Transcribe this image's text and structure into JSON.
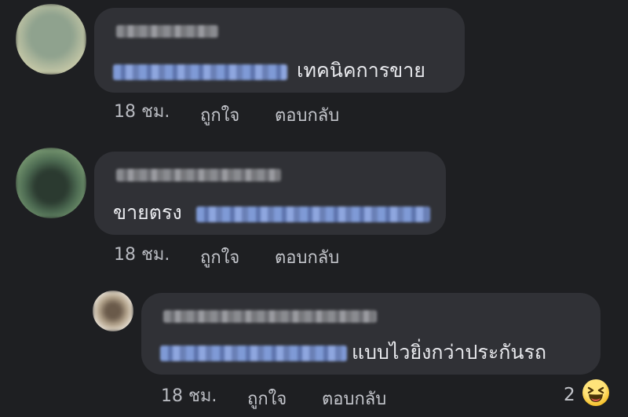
{
  "comments": [
    {
      "text_suffix": "เทคนิคการขาย",
      "time": "18 ชม.",
      "like_label": "ถูกใจ",
      "reply_label": "ตอบกลับ"
    },
    {
      "text_prefix": "ขายตรง",
      "time": "18 ชม.",
      "like_label": "ถูกใจ",
      "reply_label": "ตอบกลับ"
    },
    {
      "text_suffix": "แบบไวยิ่งกว่าประกันรถ",
      "time": "18 ชม.",
      "like_label": "ถูกใจ",
      "reply_label": "ตอบกลับ",
      "reaction_count": "2",
      "reaction_icon": "laughing-emoji-icon"
    }
  ],
  "colors": {
    "background": "#1e1f22",
    "bubble": "#303136",
    "mention": "#7f9ad6"
  }
}
